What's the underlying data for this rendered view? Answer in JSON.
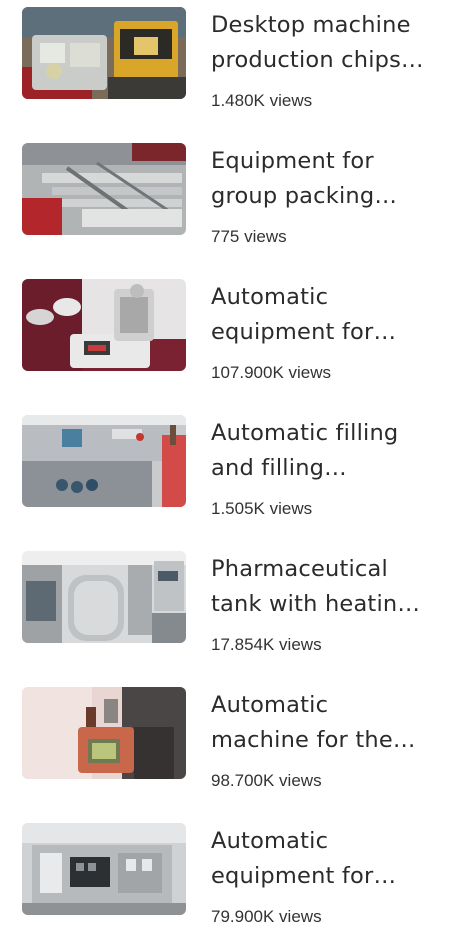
{
  "videos": [
    {
      "title_line1": "Desktop machine",
      "title_line2": "production chips…",
      "views": "1.480K views",
      "thumb_icon": "tabletop-production-machine"
    },
    {
      "title_line1": "Equipment for",
      "title_line2": "group packing…",
      "views": "775 views",
      "thumb_icon": "conveyor-packing-line"
    },
    {
      "title_line1": "Automatic",
      "title_line2": "equipment for…",
      "views": "107.900K views",
      "thumb_icon": "lab-test-instrument"
    },
    {
      "title_line1": "Automatic filling",
      "title_line2": "and filling…",
      "views": "1.505K views",
      "thumb_icon": "filling-machine"
    },
    {
      "title_line1": "Pharmaceutical",
      "title_line2": "tank with heatin…",
      "views": "17.854K views",
      "thumb_icon": "steel-tank"
    },
    {
      "title_line1": "Automatic",
      "title_line2": "machine for the…",
      "views": "98.700K views",
      "thumb_icon": "control-panel-machine"
    },
    {
      "title_line1": "Automatic",
      "title_line2": "equipment for…",
      "views": "79.900K views",
      "thumb_icon": "blister-packing-machine"
    }
  ]
}
